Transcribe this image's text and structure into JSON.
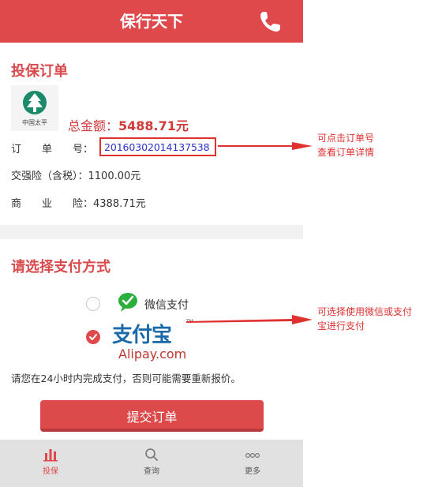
{
  "header": {
    "title": "保行天下",
    "icon": "phone-icon"
  },
  "order_section": {
    "title": "投保订单",
    "logo_text": "中国太平",
    "total_label": "总金额：",
    "total_value": "5488.71元",
    "order_no_label": "订　　单　　号：",
    "order_no": "20160302014137538",
    "compulsory_label": "交强险（含税）：",
    "compulsory_value": "1100.00元",
    "commercial_label": "商　　业　　险：",
    "commercial_value": "4388.71元"
  },
  "payment_section": {
    "title": "请选择支付方式",
    "wechat_label": "微信支付",
    "wechat_selected": false,
    "alipay_logo_cn": "支付宝",
    "alipay_logo_en": "Alipay.com",
    "alipay_tm": "TM",
    "alipay_selected": true,
    "notice": "请您在24小时内完成支付，否则可能需要重新报价。",
    "submit_label": "提交订单"
  },
  "tabbar": {
    "tabs": [
      {
        "label": "投保",
        "icon": "bar-chart-icon",
        "active": true
      },
      {
        "label": "查询",
        "icon": "search-icon",
        "active": false
      },
      {
        "label": "更多",
        "icon": "more-icon",
        "active": false
      }
    ]
  },
  "annotations": {
    "order": [
      "可点击订单号",
      "查看订单详情"
    ],
    "payment": [
      "可选择使用微信或支付",
      "宝进行支付"
    ]
  },
  "colors": {
    "brand": "#e0494b",
    "link": "#2b33c9",
    "annotation": "#e03131"
  }
}
